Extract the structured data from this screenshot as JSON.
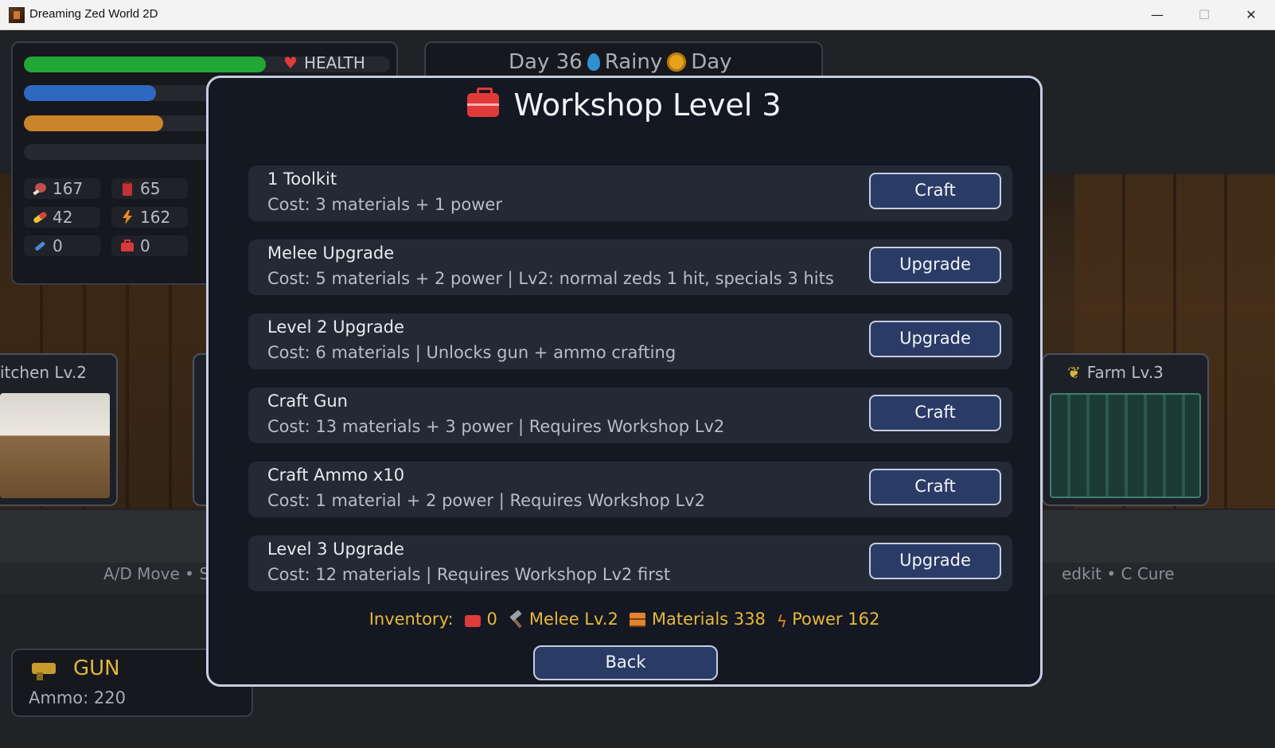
{
  "window": {
    "title": "Dreaming Zed World 2D",
    "minimize": "—",
    "maximize": "☐",
    "close": "✕"
  },
  "hud": {
    "health_label": "HEALTH",
    "bars": {
      "health": 0.66,
      "bar2": 0.36,
      "bar3": 0.38,
      "bar4": 0.0
    },
    "stats": [
      {
        "icon": "meat-icon",
        "value": "167"
      },
      {
        "icon": "fuel-can-icon",
        "value": "65"
      },
      {
        "icon": "pill-icon",
        "value": "42"
      },
      {
        "icon": "lightning-icon",
        "value": "162"
      },
      {
        "icon": "syringe-icon",
        "value": "0"
      },
      {
        "icon": "toolbox-icon",
        "value": "0"
      }
    ]
  },
  "day_panel": {
    "day": "Day 36",
    "weather": "Rainy",
    "time_of_day": "Day"
  },
  "rooms": {
    "kitchen": "itchen Lv.2",
    "farm": "Farm Lv.3"
  },
  "hints": {
    "left": "A/D Move • S",
    "right": "edkit • C Cure"
  },
  "gun_panel": {
    "title": "GUN",
    "ammo": "Ammo: 220"
  },
  "modal": {
    "title": "Workshop Level 3",
    "rows": [
      {
        "title": "1 Toolkit",
        "cost": "Cost: 3 materials + 1 power",
        "button": "Craft"
      },
      {
        "title": "Melee Upgrade",
        "cost": "Cost: 5 materials + 2 power | Lv2: normal zeds 1 hit, specials 3 hits",
        "button": "Upgrade"
      },
      {
        "title": "Level 2 Upgrade",
        "cost": "Cost: 6 materials | Unlocks gun + ammo crafting",
        "button": "Upgrade"
      },
      {
        "title": "Craft Gun",
        "cost": "Cost: 13 materials + 3 power | Requires Workshop Lv2",
        "button": "Craft"
      },
      {
        "title": "Craft Ammo x10",
        "cost": "Cost: 1 material + 2 power | Requires Workshop Lv2",
        "button": "Craft"
      },
      {
        "title": "Level 3 Upgrade",
        "cost": "Cost: 12 materials | Requires Workshop Lv2 first",
        "button": "Upgrade"
      }
    ],
    "inventory": {
      "label": "Inventory:",
      "toolkits": "0",
      "melee": "Melee Lv.2",
      "materials": "Materials 338",
      "power": "Power 162"
    },
    "back": "Back"
  },
  "colors": {
    "accent_gold": "#e5b93a",
    "button_bg": "#2a3b66",
    "health_green": "#22a636",
    "toolbox_red": "#e13a3a"
  }
}
